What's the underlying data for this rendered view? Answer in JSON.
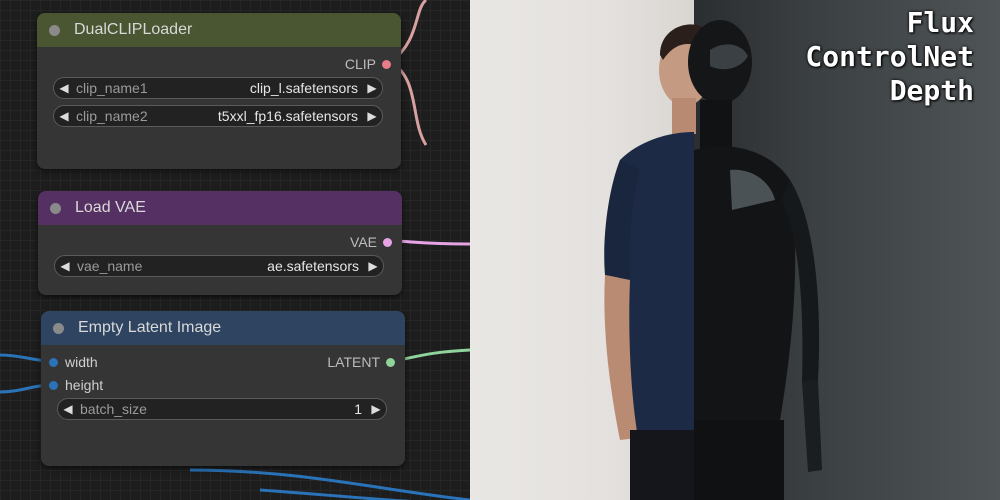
{
  "nodes": {
    "dual_clip_loader": {
      "title": "DualCLIPLoader",
      "header_color": "#4a5631",
      "output": {
        "label": "CLIP",
        "color": "#ffd500"
      },
      "widgets": [
        {
          "name": "clip_name1",
          "value": "clip_l.safetensors"
        },
        {
          "name": "clip_name2",
          "value": "t5xxl_fp16.safetensors"
        }
      ]
    },
    "load_vae": {
      "title": "Load VAE",
      "header_color": "#553063",
      "output": {
        "label": "VAE",
        "color": "#ff6e6e"
      },
      "widgets": [
        {
          "name": "vae_name",
          "value": "ae.safetensors"
        }
      ]
    },
    "empty_latent_image": {
      "title": "Empty Latent Image",
      "header_color": "#2e4460",
      "output": {
        "label": "LATENT",
        "color": "#ff9cf9"
      },
      "inputs": [
        {
          "label": "width"
        },
        {
          "label": "height"
        }
      ],
      "widgets": [
        {
          "name": "batch_size",
          "value": "1"
        }
      ]
    }
  },
  "overlay": {
    "lines": [
      "Flux",
      "ControlNet",
      "Depth"
    ]
  },
  "icons": {
    "decrement": "triangle-left-icon",
    "increment": "triangle-right-icon"
  }
}
